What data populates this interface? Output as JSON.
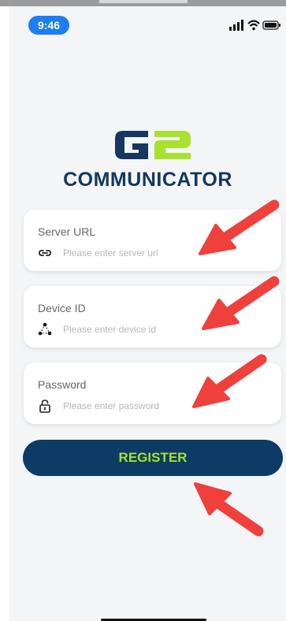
{
  "status_bar": {
    "time": "9:46",
    "icons": [
      "cellular-signal-icon",
      "wifi-icon",
      "battery-icon"
    ]
  },
  "logo": {
    "mark": "G2",
    "text": "COMMUNICATOR"
  },
  "form": {
    "server_url": {
      "label": "Server URL",
      "placeholder": "Please enter server url",
      "value": "",
      "icon": "link-icon"
    },
    "device_id": {
      "label": "Device ID",
      "placeholder": "Please enter device id",
      "value": "",
      "icon": "share-nodes-icon"
    },
    "password": {
      "label": "Password",
      "placeholder": "Please enter password",
      "value": "",
      "icon": "lock-icon"
    }
  },
  "register_button": {
    "label": "REGISTER"
  },
  "annotations": {
    "arrows": [
      "arrow-to-server-url",
      "arrow-to-device-id",
      "arrow-to-password",
      "arrow-to-register"
    ]
  },
  "colors": {
    "brand_navy": "#0c3c66",
    "brand_green": "#a8e12e",
    "status_blue": "#1d7df2",
    "arrow_red": "#f0403c"
  }
}
